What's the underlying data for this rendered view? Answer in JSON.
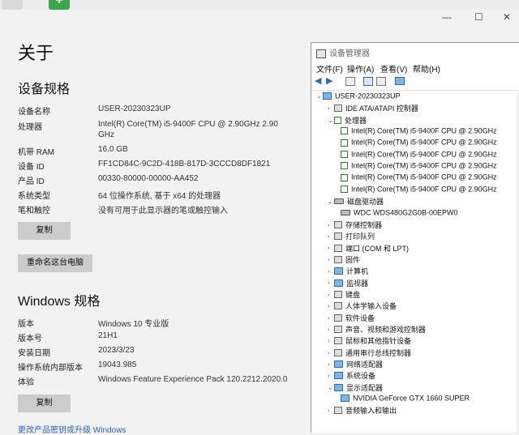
{
  "window_controls": {
    "minimize": "—",
    "maximize": "☐",
    "close": "✕"
  },
  "about": {
    "title": "关于",
    "device_spec_heading": "设备规格",
    "device_specs": [
      {
        "label": "设备名称",
        "value": "USER-20230323UP"
      },
      {
        "label": "处理器",
        "value": "Intel(R) Core(TM) i5-9400F CPU @ 2.90GHz   2.90",
        "value2": "GHz"
      },
      {
        "label": "机带 RAM",
        "value": "16.0 GB"
      },
      {
        "label": "设备 ID",
        "value": "FF1CD84C-9C2D-418B-817D-3CCCD8DF1821"
      },
      {
        "label": "产品 ID",
        "value": "00330-80000-00000-AA452"
      },
      {
        "label": "系统类型",
        "value": "64 位操作系统, 基于 x64 的处理器"
      },
      {
        "label": "笔和触控",
        "value": "没有可用于此显示器的笔或触控输入"
      }
    ],
    "copy_button_1": "复制",
    "rename_button": "重命名这台电脑",
    "windows_spec_heading": "Windows 规格",
    "windows_specs": [
      {
        "label": "版本",
        "value": "Windows 10 专业版"
      },
      {
        "label": "版本号",
        "value": "21H1"
      },
      {
        "label": "安装日期",
        "value": "2023/3/23"
      },
      {
        "label": "操作系统内部版本",
        "value": "19043.985"
      },
      {
        "label": "体验",
        "value": "Windows Feature Experience Pack 120.2212.2020.0"
      }
    ],
    "copy_button_2": "复制",
    "upgrade_link": "更改产品密钥或升级 Windows"
  },
  "device_manager": {
    "title": "设备管理器",
    "menu": [
      "文件(F)",
      "操作(A)",
      "查看(V)",
      "帮助(H)"
    ],
    "root": "USER-20230323UP",
    "nodes": [
      {
        "label": "IDE ATA/ATAPI 控制器",
        "icon": "gen",
        "expanded": false,
        "level": 1
      },
      {
        "label": "处理器",
        "icon": "chip",
        "expanded": true,
        "level": 1
      },
      {
        "label": "Intel(R) Core(TM) i5-9400F CPU @ 2.90GHz",
        "icon": "chip",
        "level": 2
      },
      {
        "label": "Intel(R) Core(TM) i5-9400F CPU @ 2.90GHz",
        "icon": "chip",
        "level": 2
      },
      {
        "label": "Intel(R) Core(TM) i5-9400F CPU @ 2.90GHz",
        "icon": "chip",
        "level": 2
      },
      {
        "label": "Intel(R) Core(TM) i5-9400F CPU @ 2.90GHz",
        "icon": "chip",
        "level": 2
      },
      {
        "label": "Intel(R) Core(TM) i5-9400F CPU @ 2.90GHz",
        "icon": "chip",
        "level": 2
      },
      {
        "label": "Intel(R) Core(TM) i5-9400F CPU @ 2.90GHz",
        "icon": "chip",
        "level": 2
      },
      {
        "label": "磁盘驱动器",
        "icon": "drive",
        "expanded": true,
        "level": 1
      },
      {
        "label": "WDC WDS480G2G0B-00EPW0",
        "icon": "drive",
        "level": 2
      },
      {
        "label": "存储控制器",
        "icon": "gen",
        "expanded": false,
        "level": 1
      },
      {
        "label": "打印队列",
        "icon": "gen",
        "expanded": false,
        "level": 1
      },
      {
        "label": "端口 (COM 和 LPT)",
        "icon": "gen",
        "expanded": false,
        "level": 1
      },
      {
        "label": "固件",
        "icon": "gen",
        "expanded": false,
        "level": 1
      },
      {
        "label": "计算机",
        "icon": "monitor",
        "expanded": false,
        "level": 1
      },
      {
        "label": "监视器",
        "icon": "monitor",
        "expanded": false,
        "level": 1
      },
      {
        "label": "键盘",
        "icon": "gen",
        "expanded": false,
        "level": 1
      },
      {
        "label": "人体学输入设备",
        "icon": "gen",
        "expanded": false,
        "level": 1
      },
      {
        "label": "软件设备",
        "icon": "gen",
        "expanded": false,
        "level": 1
      },
      {
        "label": "声音、视频和游戏控制器",
        "icon": "gen",
        "expanded": false,
        "level": 1
      },
      {
        "label": "鼠标和其他指针设备",
        "icon": "gen",
        "expanded": false,
        "level": 1
      },
      {
        "label": "通用串行总线控制器",
        "icon": "gen",
        "expanded": false,
        "level": 1
      },
      {
        "label": "网络适配器",
        "icon": "monitor",
        "expanded": false,
        "level": 1
      },
      {
        "label": "系统设备",
        "icon": "monitor",
        "expanded": false,
        "level": 1
      },
      {
        "label": "显示适配器",
        "icon": "monitor",
        "expanded": true,
        "level": 1
      },
      {
        "label": "NVIDIA GeForce GTX 1660 SUPER",
        "icon": "monitor",
        "level": 2
      },
      {
        "label": "音频输入和输出",
        "icon": "gen",
        "expanded": false,
        "level": 1
      }
    ]
  },
  "colors": {
    "accent_link": "#2b62c2",
    "button_bg": "#cccccc",
    "icon_blue": "#2a6db0",
    "cpu_green": "#2e7d32"
  }
}
